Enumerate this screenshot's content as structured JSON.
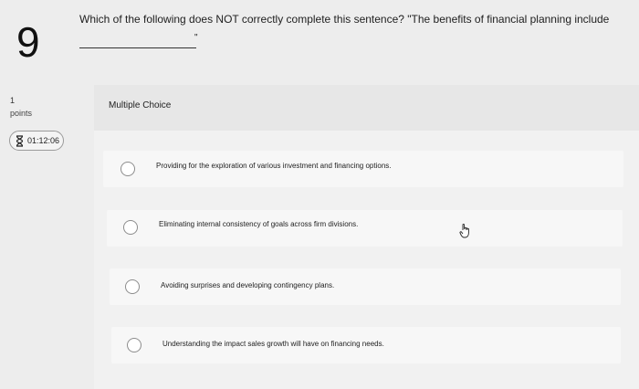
{
  "question": {
    "number": "9",
    "points_value": "1",
    "points_label": "points",
    "timer": "01:12:06",
    "text": "Which of the following does NOT correctly complete this sentence? \"The benefits of financial planning include",
    "closing_quote": "\""
  },
  "answer_section": {
    "type_label": "Multiple Choice",
    "options": [
      {
        "label": "Providing for the exploration of various investment and financing options."
      },
      {
        "label": "Eliminating internal consistency of goals across firm divisions."
      },
      {
        "label": "Avoiding surprises and developing contingency plans."
      },
      {
        "label": "Understanding the impact sales growth will have on financing needs."
      }
    ]
  },
  "icons": {
    "timer": "hourglass-icon",
    "pointer": "hand-pointer-icon"
  },
  "colors": {
    "background": "#ededed",
    "panel": "#f1f1f1",
    "radio_border": "#8c8c8c"
  }
}
